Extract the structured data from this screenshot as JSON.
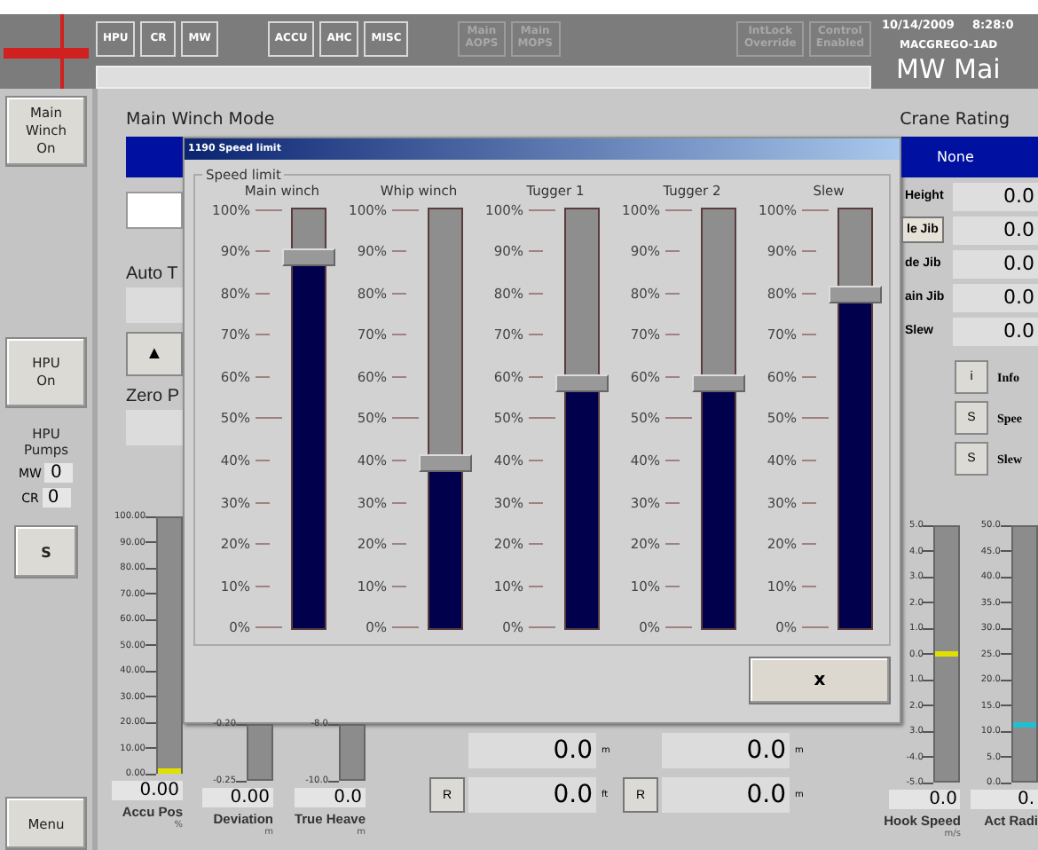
{
  "top_bar": {
    "nav_groups": [
      [
        {
          "label": "HPU",
          "disabled": false
        },
        {
          "label": "CR",
          "disabled": false
        },
        {
          "label": "MW",
          "disabled": false
        }
      ],
      [
        {
          "label": "ACCU",
          "disabled": false
        },
        {
          "label": "AHC",
          "disabled": false
        },
        {
          "label": "MISC",
          "disabled": false
        }
      ],
      [
        {
          "label": "Main\nAOPS",
          "disabled": true
        },
        {
          "label": "Main\nMOPS",
          "disabled": true
        }
      ],
      [
        {
          "label": "IntLock\nOverride",
          "disabled": true
        },
        {
          "label": "Control\nEnabled",
          "disabled": true
        }
      ]
    ],
    "date": "10/14/2009",
    "time": "8:28:0",
    "station": "MACGREGO-1AD",
    "screen_title": "MW Mai"
  },
  "sidebar": {
    "main_winch_button": "Main\nWinch\nOn",
    "hpu_button": "HPU\nOn",
    "pumps_label": "HPU\nPumps",
    "pumps": [
      {
        "name": "MW",
        "value": "0"
      },
      {
        "name": "CR",
        "value": "0"
      }
    ],
    "s_button": "S",
    "menu_button": "Menu"
  },
  "main": {
    "mode_label": "Main Winch Mode",
    "auto_label": "Auto T",
    "up_button": "▲",
    "zero_label": "Zero P",
    "accu_gauge": {
      "ticks": [
        "100.00",
        "90.00",
        "80.00",
        "70.00",
        "60.00",
        "50.00",
        "40.00",
        "30.00",
        "20.00",
        "10.00",
        "0.00"
      ],
      "level": 0,
      "color": "#e0e000",
      "value": "0.00",
      "label": "Accu Pos",
      "unit": "%"
    },
    "bottom_gauges": [
      {
        "ticks": [
          "-0.20",
          "-0.25"
        ],
        "value": "0.00",
        "label": "Deviation",
        "unit": "m"
      },
      {
        "ticks": [
          "-8.0",
          "-10.0"
        ],
        "value": "0.0",
        "label": "True Heave",
        "unit": "m"
      }
    ],
    "readouts": [
      {
        "value": "0.0",
        "unit": "m"
      },
      {
        "value": "0.0",
        "unit": "ft",
        "reset": "R"
      }
    ],
    "readouts_2": [
      {
        "value": "0.0",
        "unit": "m"
      },
      {
        "value": "0.0",
        "unit": "m",
        "reset": "R"
      }
    ],
    "crane_rating": {
      "label": "Crane Rating",
      "value": "None",
      "rows": [
        {
          "label": "Height",
          "kind": "label",
          "value": "0.0"
        },
        {
          "label": "le Jib",
          "kind": "button",
          "value": "0.0"
        },
        {
          "label": "de Jib",
          "kind": "label",
          "value": "0.0"
        },
        {
          "label": "ain Jib",
          "kind": "label",
          "value": "0.0"
        },
        {
          "label": "Slew",
          "kind": "label",
          "value": "0.0"
        }
      ]
    },
    "side_buttons": [
      {
        "key": "i",
        "label": "Info"
      },
      {
        "key": "S",
        "label": "Spee"
      },
      {
        "key": "S",
        "label": "Slew"
      }
    ],
    "right_gauges": [
      {
        "ticks": [
          "5.0",
          "4.0",
          "3.0",
          "2.0",
          "1.0",
          "0.0",
          "1.0",
          "2.0",
          "3.0",
          "-4.0",
          "-5.0"
        ],
        "level": 0.5,
        "color": "#e0e000",
        "value": "0.0",
        "label": "Hook Speed",
        "unit": "m/s"
      },
      {
        "ticks": [
          "50.0",
          "45.0",
          "40.0",
          "35.0",
          "30.0",
          "25.0",
          "20.0",
          "15.0",
          "10.0",
          "5.0",
          "0.0"
        ],
        "level": 0.22,
        "color": "#20c0d0",
        "value": "0.",
        "label": "Act Radi"
      }
    ]
  },
  "dialog": {
    "title": "1190 Speed limit",
    "group": "Speed limit",
    "close_button": "x",
    "sliders": [
      {
        "name": "Main winch",
        "level": 0.89,
        "ticks": [
          "100%",
          "90%",
          "80%",
          "70%",
          "60%",
          "50%",
          "40%",
          "30%",
          "20%",
          "10%",
          "0%"
        ]
      },
      {
        "name": "Whip winch",
        "level": 0.4,
        "ticks": [
          "100%",
          "90%",
          "80%",
          "70%",
          "60%",
          "50%",
          "40%",
          "30%",
          "20%",
          "10%",
          "0%"
        ]
      },
      {
        "name": "Tugger 1",
        "level": 0.59,
        "ticks": [
          "100%",
          "90%",
          "80%",
          "70%",
          "60%",
          "50%",
          "40%",
          "30%",
          "20%",
          "10%",
          "0%"
        ]
      },
      {
        "name": "Tugger 2",
        "level": 0.59,
        "ticks": [
          "100%",
          "90%",
          "80%",
          "70%",
          "60%",
          "50%",
          "40%",
          "30%",
          "20%",
          "10%",
          "0%"
        ]
      },
      {
        "name": "Slew",
        "level": 0.8,
        "ticks": [
          "100%",
          "90%",
          "80%",
          "70%",
          "60%",
          "50%",
          "40%",
          "30%",
          "20%",
          "10%",
          "0%"
        ]
      }
    ]
  }
}
